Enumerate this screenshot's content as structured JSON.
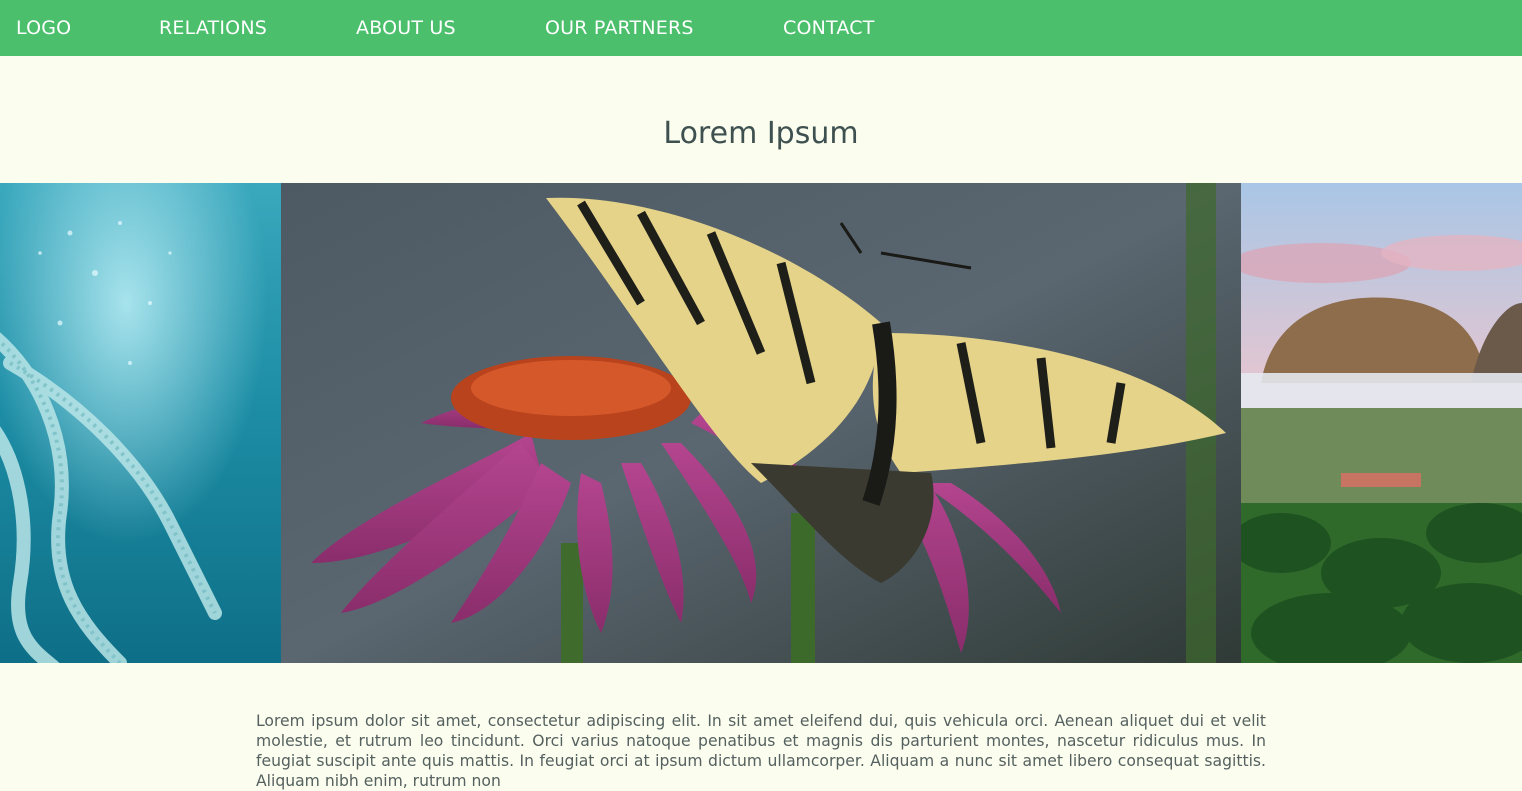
{
  "nav": {
    "logo": "LOGO",
    "items": [
      {
        "label": "RELATIONS"
      },
      {
        "label": "ABOUT US"
      },
      {
        "label": "OUR PARTNERS"
      },
      {
        "label": "CONTACT"
      }
    ]
  },
  "main": {
    "title": "Lorem Ipsum",
    "body": "Lorem ipsum dolor sit amet, consectetur adipiscing elit. In sit amet eleifend dui, quis vehicula orci. Aenean aliquet dui et velit molestie, et rutrum leo tincidunt. Orci varius natoque penatibus et magnis dis parturient montes, nascetur ridiculus mus. In feugiat suscipit ante quis mattis. In feugiat orci at ipsum dictum ullamcorper. Aliquam a nunc sit amet libero consequat sagittis. Aliquam nibh enim, rutrum non"
  },
  "colors": {
    "navbar": "#4bbf6b",
    "background": "#fbfeee",
    "title": "#3e5050",
    "body_text": "#556060"
  },
  "carousel": {
    "slides": [
      {
        "icon": "jellyfish-photo"
      },
      {
        "icon": "butterfly-on-coneflower-photo"
      },
      {
        "icon": "mountain-valley-landscape-photo"
      }
    ]
  }
}
